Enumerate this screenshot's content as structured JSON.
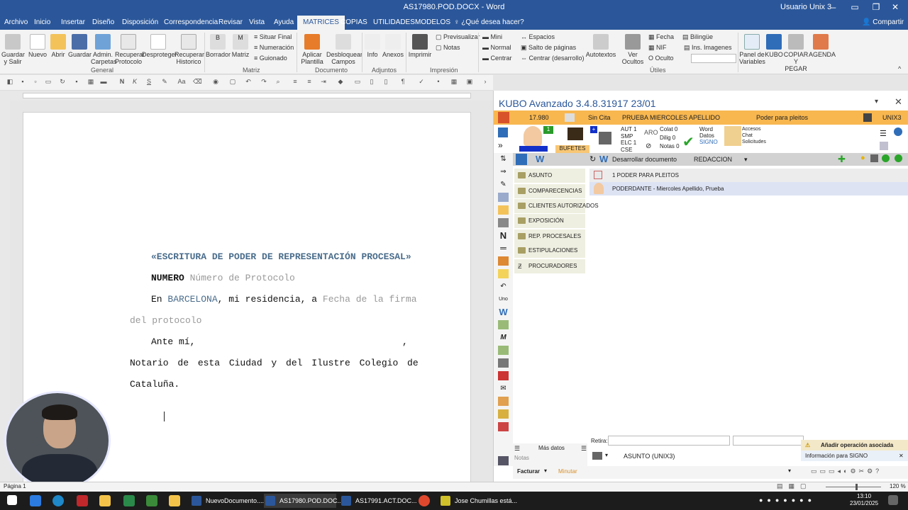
{
  "window": {
    "title": "AS17980.POD.DOCX  -  Word",
    "user": "Usuario Unix 3"
  },
  "tabs": [
    "Archivo",
    "Inicio",
    "Insertar",
    "Diseño",
    "Disposición",
    "Correspondencia",
    "Revisar",
    "Vista",
    "Ayuda",
    "MATRICES",
    "COPIAS",
    "UTILIDADES",
    "MODELOS",
    "¿Qué desea hacer?"
  ],
  "active_tab": "MATRICES",
  "share_label": "Compartir",
  "ribbon": {
    "general": [
      "Guardar y Salir",
      "Nuevo",
      "Abrir",
      "Guardar",
      "Admin. Carpetas",
      "Recuperar Protocolo",
      "Desproteger",
      "Recuperar Historico"
    ],
    "matriz_big": [
      "Borrador",
      "Matriz"
    ],
    "matriz_small": [
      "Situar Final",
      "Numeración",
      "Guionado"
    ],
    "documento": [
      "Aplicar Plantilla",
      "Desbloquear Campos"
    ],
    "adjuntos": [
      "Info",
      "Anexos"
    ],
    "impresion": [
      "Imprimir"
    ],
    "impresion_small": [
      "Previsualizar",
      "Notas"
    ],
    "format_small": [
      "Mini",
      "Normal",
      "Centrar"
    ],
    "spaces_small": [
      "Espacios",
      "Salto de páginas",
      "Centrar (desarrollo)"
    ],
    "autotextos": "Autotextos",
    "ver_ocultos": "Ver Ocultos",
    "utiles_small": [
      "Fecha",
      "NIF",
      "Oculto"
    ],
    "lang_small": [
      "Bilingüe",
      "Ins. Imagenes"
    ],
    "right_big": [
      "Panel de Variables",
      "KUBO",
      "COPIAR Y PEGAR",
      "AGENDA"
    ],
    "groups": [
      "General",
      "Matriz",
      "Documento",
      "Adjuntos",
      "Impresión",
      "Útiles"
    ]
  },
  "document": {
    "heading": "«ESCRITURA DE PODER DE REPRESENTACIÓN PROCESAL»",
    "numero_label": "NUMERO",
    "numero_value": "Número de Protocolo",
    "line3_a": "En",
    "line3_city": "BARCELONA",
    "line3_b": ", mi residencia, a",
    "line3_field": "Fecha de la firma",
    "line4_field": "del protocolo",
    "line5": "Ante   mí,",
    "line5_comma": ",",
    "line6": "Notario de esta Ciudad y del Ilustre Colegio de",
    "line7": "Cataluña."
  },
  "kubo": {
    "title": "KUBO Avanzado 3.4.8.31917   23/01",
    "infobar": {
      "num": "17.980",
      "cita": "Sin Cita",
      "cliente": "PRUEBA MIERCOLES APELLIDO",
      "tipo": "Poder para pleitos",
      "user": "UNIX3"
    },
    "badge": "1",
    "bufetes": "BUFETES",
    "counts": {
      "aut": "AUT  1",
      "smp": "SMP",
      "elc": "ELC  1",
      "cse": "CSE"
    },
    "colat": "Colat  0",
    "dilig": "Dilig  0",
    "notas": "Notas  0",
    "word_datos": [
      "Word",
      "Datos",
      "SIGNO"
    ],
    "accesos": [
      "Accesos",
      "Chat",
      "Solicitudes"
    ],
    "desarrollar": "Desarrollar documento",
    "redaccion": "REDACCION",
    "sections": [
      "ASUNTO",
      "COMPARECENCIAS",
      "CLIENTES AUTORIZADOS",
      "EXPOSICIÓN",
      "REP. PROCESALES",
      "ESTIPULACIONES",
      "PROCURADORES"
    ],
    "doc_rows": [
      "1 PODER PARA PLEITOS",
      "PODERDANTE - Miercoles Apellido, Prueba"
    ],
    "mas_datos": "Más datos",
    "notas_label": "Notas",
    "retira_label": "Retira:",
    "asunto_row": "ASUNTO (UNIX3)",
    "facturar": "Facturar",
    "minutar": "Minutar",
    "notif_title": "Añadir operación asociada",
    "notif_info": "Información para SIGNO"
  },
  "status": {
    "page": "Página 1",
    "zoom": "120 %"
  },
  "taskbar": {
    "items": [
      "NuevoDocumento....",
      "AS17980.POD.DOC...",
      "AS17991.ACT.DOC...",
      "Jose Chumillas está..."
    ],
    "time": "13:10",
    "date": "23/01/2025"
  }
}
